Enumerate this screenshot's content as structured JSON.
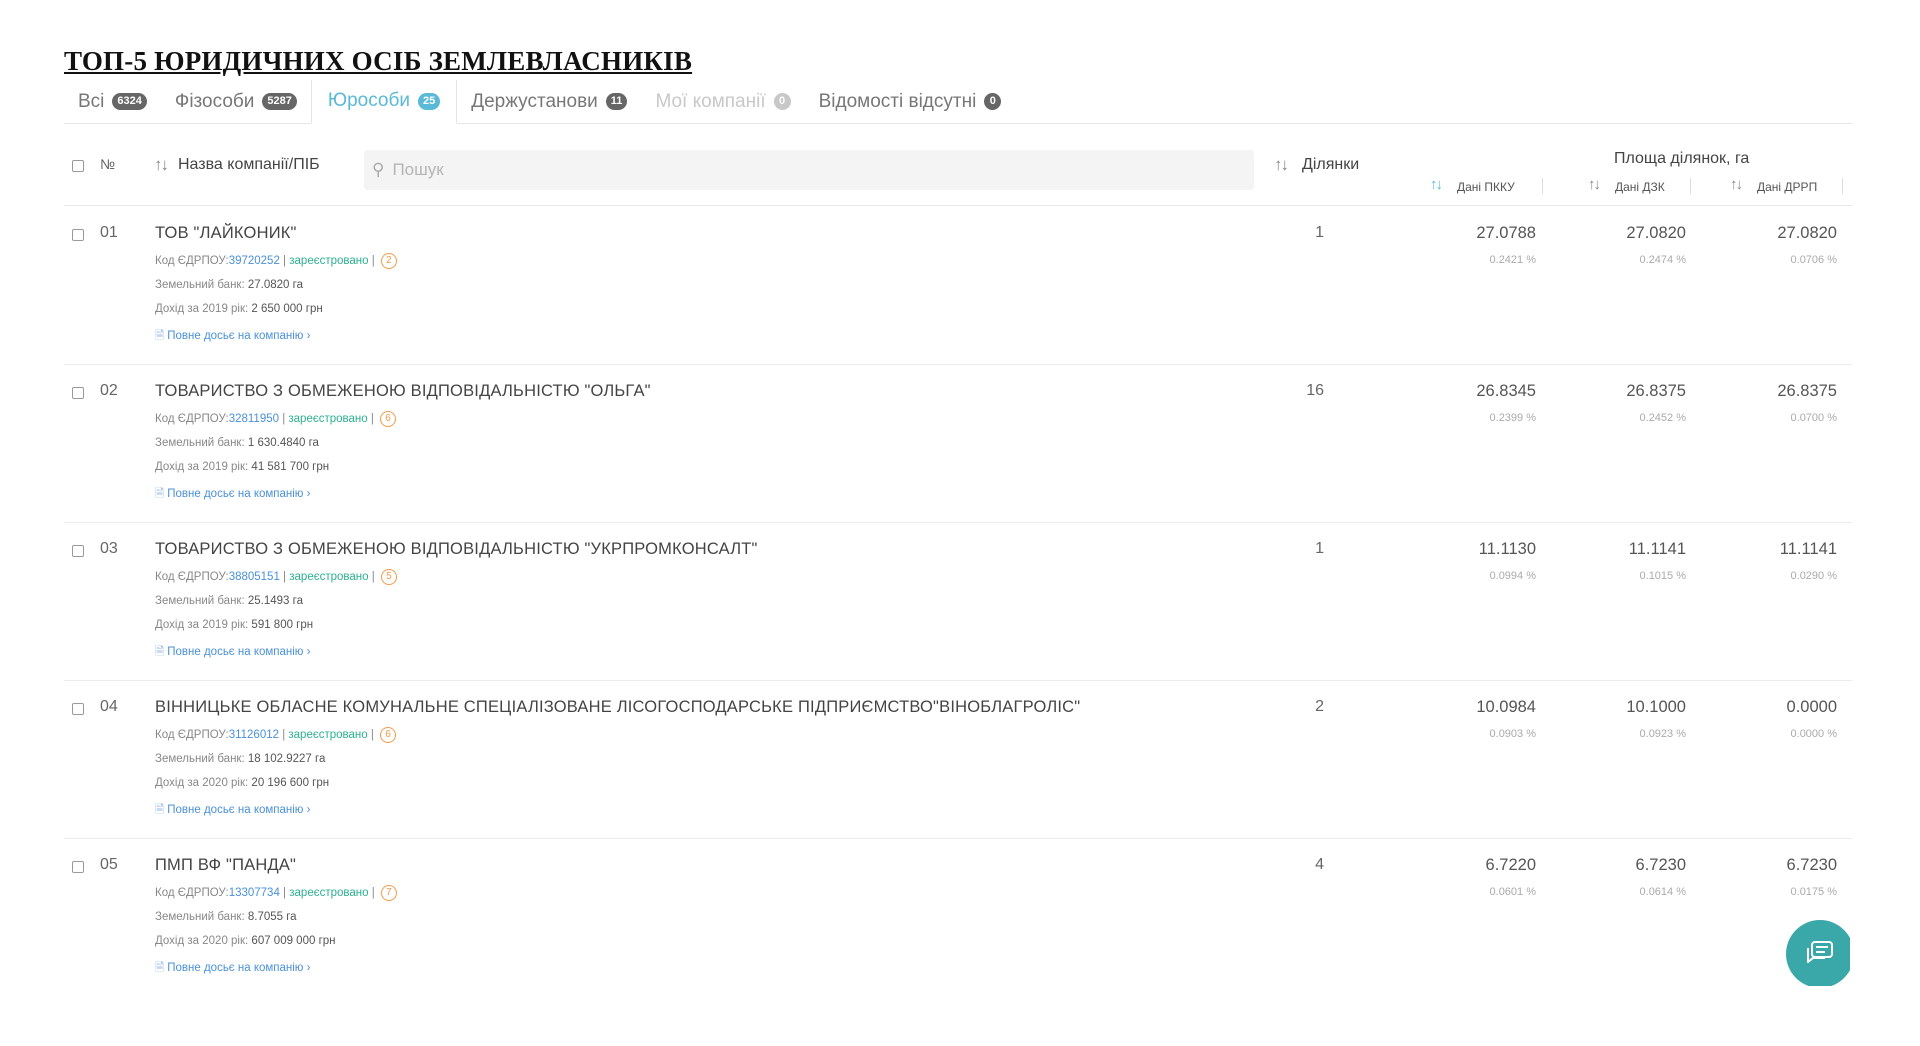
{
  "page": {
    "title": "ТОП-5 ЮРИДИЧНИХ ОСІБ ЗЕМЛЕВЛАСНИКІВ"
  },
  "tabs": [
    {
      "label": "Всі",
      "badge": "6324",
      "state": "normal"
    },
    {
      "label": "Фізособи",
      "badge": "5287",
      "state": "normal"
    },
    {
      "label": "Юрособи",
      "badge": "25",
      "state": "active"
    },
    {
      "label": "Держустанови",
      "badge": "11",
      "state": "normal"
    },
    {
      "label": "Мої компанії",
      "badge": "0",
      "state": "muted"
    },
    {
      "label": "Відомості відсутні",
      "badge": "0",
      "state": "normal"
    }
  ],
  "header": {
    "num": "№",
    "name": "Назва компанії/ПІБ",
    "search_placeholder": "Пошук",
    "plots": "Ділянки",
    "area_title": "Площа ділянок, га",
    "area_cols": [
      "Дані ПККУ",
      "Дані ДЗК",
      "Дані ДРРП"
    ]
  },
  "meta_labels": {
    "code": "Код ЄДРПОУ:",
    "land_bank": "Земельний банк:",
    "dossier": "Повне досьє на компанію ›"
  },
  "rows": [
    {
      "num": "01",
      "name": "ТОВ \"ЛАЙКОНИК\"",
      "code": "39720252",
      "status": "зареєстровано",
      "risk": "2",
      "land_bank": "27.0820 га",
      "income_label": "Дохід за 2019 рік:",
      "income": "2 650 000 грн",
      "plots": "1",
      "pkku": "27.0788",
      "pkku_pct": "0.2421 %",
      "dzk": "27.0820",
      "dzk_pct": "0.2474 %",
      "drrp": "27.0820",
      "drrp_pct": "0.0706 %"
    },
    {
      "num": "02",
      "name": "ТОВАРИСТВО З ОБМЕЖЕНОЮ ВІДПОВІДАЛЬНІСТЮ \"ОЛЬГА\"",
      "code": "32811950",
      "status": "зареєстровано",
      "risk": "6",
      "land_bank": "1 630.4840 га",
      "income_label": "Дохід за 2019 рік:",
      "income": "41 581 700 грн",
      "plots": "16",
      "pkku": "26.8345",
      "pkku_pct": "0.2399 %",
      "dzk": "26.8375",
      "dzk_pct": "0.2452 %",
      "drrp": "26.8375",
      "drrp_pct": "0.0700 %"
    },
    {
      "num": "03",
      "name": "ТОВАРИСТВО З ОБМЕЖЕНОЮ ВІДПОВІДАЛЬНІСТЮ \"УКРПРОМКОНСАЛТ\"",
      "code": "38805151",
      "status": "зареєстровано",
      "risk": "5",
      "land_bank": "25.1493 га",
      "income_label": "Дохід за 2019 рік:",
      "income": "591 800 грн",
      "plots": "1",
      "pkku": "11.1130",
      "pkku_pct": "0.0994 %",
      "dzk": "11.1141",
      "dzk_pct": "0.1015 %",
      "drrp": "11.1141",
      "drrp_pct": "0.0290 %"
    },
    {
      "num": "04",
      "name": "ВІННИЦЬКЕ ОБЛАСНЕ КОМУНАЛЬНЕ СПЕЦІАЛІЗОВАНЕ ЛІСОГОСПОДАРСЬКЕ ПІДПРИЄМСТВО\"ВІНОБЛАГРОЛІС\"",
      "code": "31126012",
      "status": "зареєстровано",
      "risk": "6",
      "land_bank": "18 102.9227 га",
      "income_label": "Дохід за 2020 рік:",
      "income": "20 196 600 грн",
      "plots": "2",
      "pkku": "10.0984",
      "pkku_pct": "0.0903 %",
      "dzk": "10.1000",
      "dzk_pct": "0.0923 %",
      "drrp": "0.0000",
      "drrp_pct": "0.0000 %"
    },
    {
      "num": "05",
      "name": "ПМП ВФ \"ПАНДА\"",
      "code": "13307734",
      "status": "зареєстровано",
      "risk": "7",
      "land_bank": "8.7055 га",
      "income_label": "Дохід за 2020 рік:",
      "income": "607 009 000 грн",
      "plots": "4",
      "pkku": "6.7220",
      "pkku_pct": "0.0601 %",
      "dzk": "6.7230",
      "dzk_pct": "0.0614 %",
      "drrp": "6.7230",
      "drrp_pct": "0.0175 %"
    }
  ],
  "colors": {
    "accent": "#5ab9d6",
    "link": "#4a90d9",
    "status": "#2bb08f",
    "risk": "#f39a4b",
    "chat": "#3aa7a9"
  },
  "icons": {
    "sort": "sort-arrows-icon",
    "search": "search-icon",
    "chat": "chat-icon",
    "dossier": "document-icon"
  }
}
